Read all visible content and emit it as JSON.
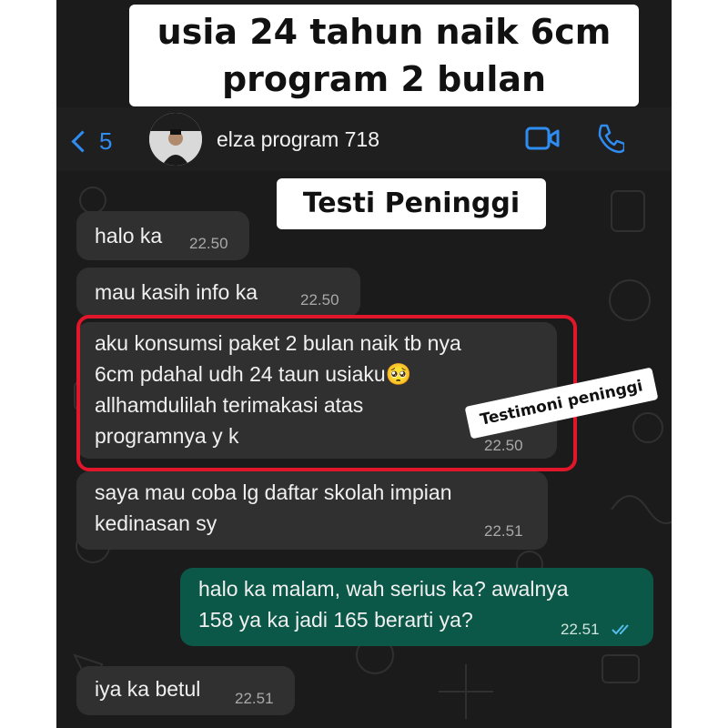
{
  "caption": {
    "line1": "usia 24 tahun naik 6cm",
    "line2": "program 2 bulan"
  },
  "header": {
    "back_count": "5",
    "contact_name": "elza program 718",
    "icons": [
      "chevron-left-icon",
      "video-call-icon",
      "phone-icon"
    ],
    "accent_color": "#2f8cf0"
  },
  "stamp_title": "Testi Peninggi",
  "sticker_label": "Testimoni peninggi",
  "messages": [
    {
      "direction": "in",
      "text": "halo ka",
      "time": "22.50"
    },
    {
      "direction": "in",
      "text": "mau kasih info ka",
      "time": "22.50"
    },
    {
      "direction": "in",
      "text": "aku konsumsi paket 2 bulan naik tb nya\n6cm pdahal udh 24 taun usiaku🥺\nallhamdulilah terimakasi atas\nprogramnya y k",
      "time": "22.50",
      "highlighted": true
    },
    {
      "direction": "in",
      "text": "saya mau coba lg daftar skolah impian\nkedinasan sy",
      "time": "22.51"
    },
    {
      "direction": "out",
      "text": "halo ka malam, wah serius ka? awalnya\n158 ya ka jadi 165 berarti ya?",
      "time": "22.51",
      "status": "read"
    },
    {
      "direction": "in",
      "text": "iya ka betul",
      "time": "22.51"
    }
  ],
  "colors": {
    "incoming_bubble": "#303030",
    "outgoing_bubble": "#0c5848",
    "highlight_border": "#e2162b",
    "read_ticks": "#53bdeb"
  }
}
